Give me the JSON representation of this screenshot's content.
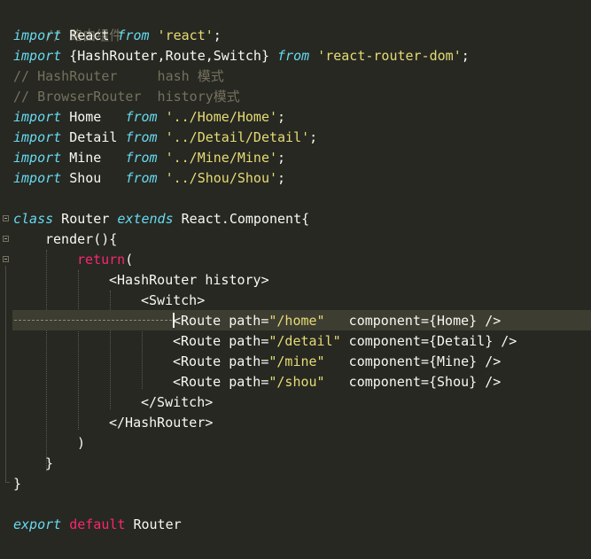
{
  "code": {
    "l1_comment": "// 路由组件",
    "l2_kw": "import",
    "l2_name": " React ",
    "l2_from": "from",
    "l2_str": " 'react'",
    "l2_end": ";",
    "l3_kw": "import",
    "l3_names": " {HashRouter,Route,Switch} ",
    "l3_from": "from",
    "l3_str": " 'react-router-dom'",
    "l3_end": ";",
    "l4_comment": "// HashRouter     hash 模式",
    "l5_comment": "// BrowserRouter  history模式",
    "l6_kw": "import",
    "l6_name": " Home   ",
    "l6_from": "from",
    "l6_str": " '../Home/Home'",
    "l6_end": ";",
    "l7_kw": "import",
    "l7_name": " Detail ",
    "l7_from": "from",
    "l7_str": " '../Detail/Detail'",
    "l7_end": ";",
    "l8_kw": "import",
    "l8_name": " Mine   ",
    "l8_from": "from",
    "l8_str": " '../Mine/Mine'",
    "l8_end": ";",
    "l9_kw": "import",
    "l9_name": " Shou   ",
    "l9_from": "from",
    "l9_str": " '../Shou/Shou'",
    "l9_end": ";",
    "l11_class": "class",
    "l11_name": " Router ",
    "l11_extends": "extends",
    "l11_rest": " React.Component{",
    "l12_render": "render",
    "l12_rest": "(){",
    "l13_return": "return",
    "l13_rest": "(",
    "l14_text": "<HashRouter history>",
    "l15_text": "<Switch>",
    "l16_open": "<Route path=",
    "l16_str": "\"/home\"",
    "l16_rest": "   component={Home} />",
    "l17_open": "<Route path=",
    "l17_str": "\"/detail\"",
    "l17_rest": " component={Detail} />",
    "l18_open": "<Route path=",
    "l18_str": "\"/mine\"",
    "l18_rest": "   component={Mine} />",
    "l19_open": "<Route path=",
    "l19_str": "\"/shou\"",
    "l19_rest": "   component={Shou} />",
    "l20_text": "</Switch>",
    "l21_text": "</HashRouter>",
    "l22_text": ")",
    "l23_text": "}",
    "l24_text": "}",
    "l26_export": "export",
    "l26_default": "default",
    "l26_name": " Router"
  },
  "colors": {
    "background": "#272822",
    "comment": "#75715e",
    "keyword": "#66d9ef",
    "reserved": "#f92672",
    "string": "#e6db74",
    "text": "#f8f8f2",
    "active_line": "#3e3d32"
  }
}
